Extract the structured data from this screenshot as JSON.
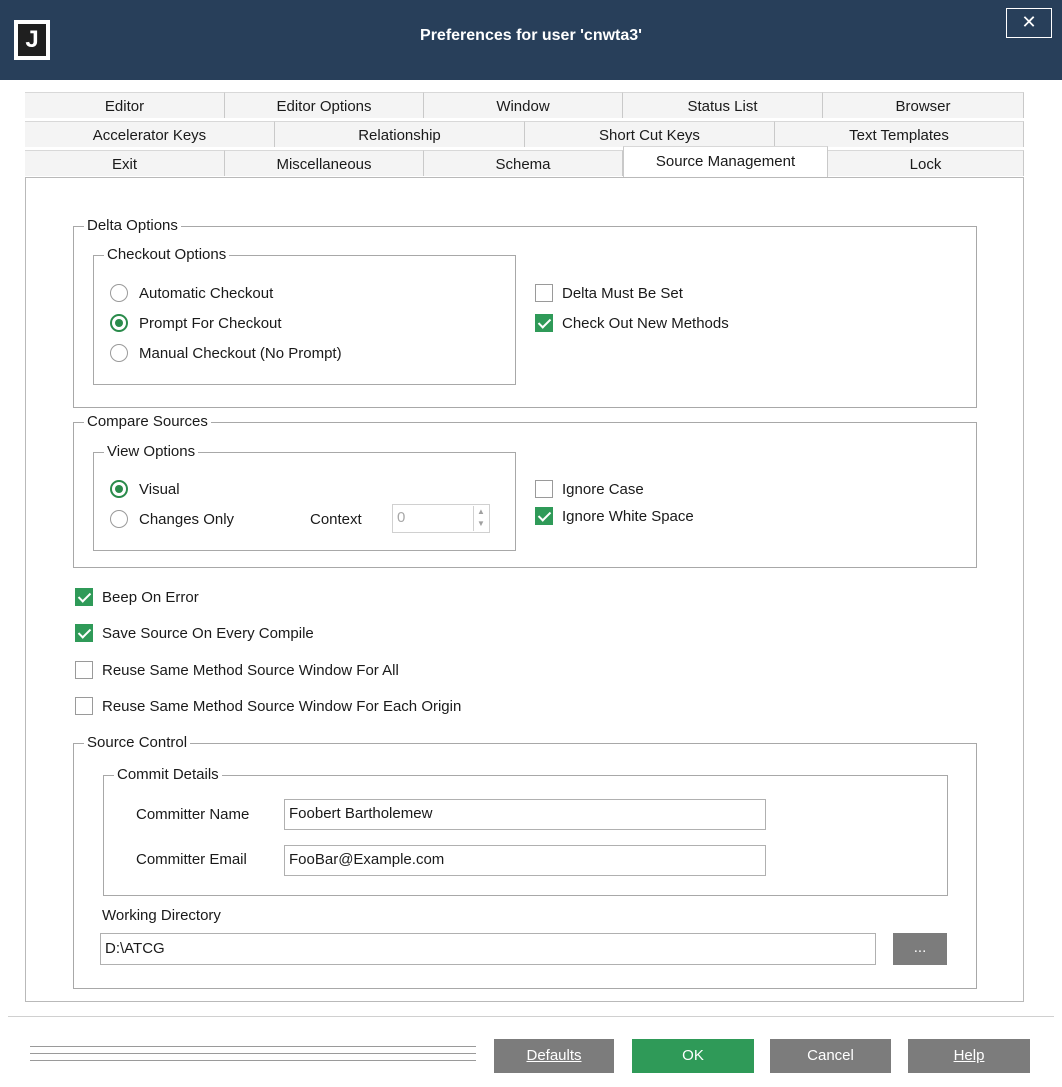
{
  "window": {
    "title": "Preferences for user 'cnwta3'",
    "logo": "J",
    "close_label": "✕"
  },
  "tabs": {
    "row1": [
      "Editor",
      "Editor Options",
      "Window",
      "Status List",
      "Browser"
    ],
    "row2": [
      "Accelerator Keys",
      "Relationship",
      "Short Cut Keys",
      "Text Templates"
    ],
    "row3": [
      "Exit",
      "Miscellaneous",
      "Schema",
      "Source Management",
      "Lock"
    ],
    "selected": "Source Management"
  },
  "delta_options": {
    "legend": "Delta Options",
    "checkout_legend": "Checkout Options",
    "radios": [
      {
        "label": "Automatic Checkout",
        "selected": false
      },
      {
        "label": "Prompt For Checkout",
        "selected": true
      },
      {
        "label": "Manual Checkout (No Prompt)",
        "selected": false
      }
    ],
    "checks": [
      {
        "label": "Delta Must Be Set",
        "checked": false
      },
      {
        "label": "Check Out New Methods",
        "checked": true
      }
    ]
  },
  "compare_sources": {
    "legend": "Compare Sources",
    "view_legend": "View Options",
    "radios": [
      {
        "label": "Visual",
        "selected": true
      },
      {
        "label": "Changes Only",
        "selected": false
      }
    ],
    "context_label": "Context",
    "context_value": "0",
    "checks": [
      {
        "label": "Ignore Case",
        "checked": false
      },
      {
        "label": "Ignore White Space",
        "checked": true
      }
    ]
  },
  "general_checks": [
    {
      "label": "Beep On Error",
      "checked": true
    },
    {
      "label": "Save Source On Every Compile",
      "checked": true
    },
    {
      "label": "Reuse Same Method Source Window For All",
      "checked": false
    },
    {
      "label": "Reuse Same Method Source Window For Each Origin",
      "checked": false
    }
  ],
  "source_control": {
    "legend": "Source Control",
    "commit_legend": "Commit Details",
    "name_label": "Committer Name",
    "name_value": "Foobert Bartholemew",
    "email_label": "Committer Email",
    "email_value": "FooBar@Example.com",
    "workdir_label": "Working Directory",
    "workdir_value": "D:\\ATCG",
    "browse_label": "..."
  },
  "buttons": {
    "defaults": "Defaults",
    "ok": "OK",
    "cancel": "Cancel",
    "help": "Help"
  },
  "colors": {
    "title_bar": "#283f5a",
    "accent_green": "#2f9a58",
    "button_gray": "#7c7c7c"
  }
}
